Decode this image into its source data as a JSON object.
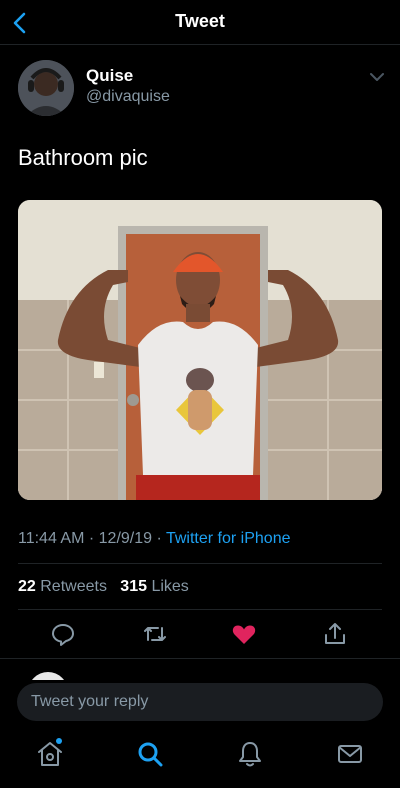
{
  "header": {
    "title": "Tweet"
  },
  "author": {
    "name": "Quise",
    "handle": "@divaquise"
  },
  "tweet": {
    "text": "Bathroom pic",
    "time": "11:44 AM",
    "date": "12/9/19",
    "separator": "·",
    "source": "Twitter for iPhone"
  },
  "stats": {
    "retweets_count": "22",
    "retweets_label": "Retweets",
    "likes_count": "315",
    "likes_label": "Likes"
  },
  "reply": {
    "placeholder": "Tweet your reply"
  },
  "colors": {
    "accent": "#1da1f2",
    "like": "#e0245e",
    "muted": "#8899a6",
    "background": "#000000"
  },
  "icons": {
    "back": "chevron-left-icon",
    "more": "chevron-down-icon",
    "reply": "comment-icon",
    "retweet": "retweet-icon",
    "like": "heart-icon",
    "share": "share-icon",
    "home": "home-icon",
    "search": "search-icon",
    "notifications": "bell-icon",
    "messages": "envelope-icon"
  }
}
